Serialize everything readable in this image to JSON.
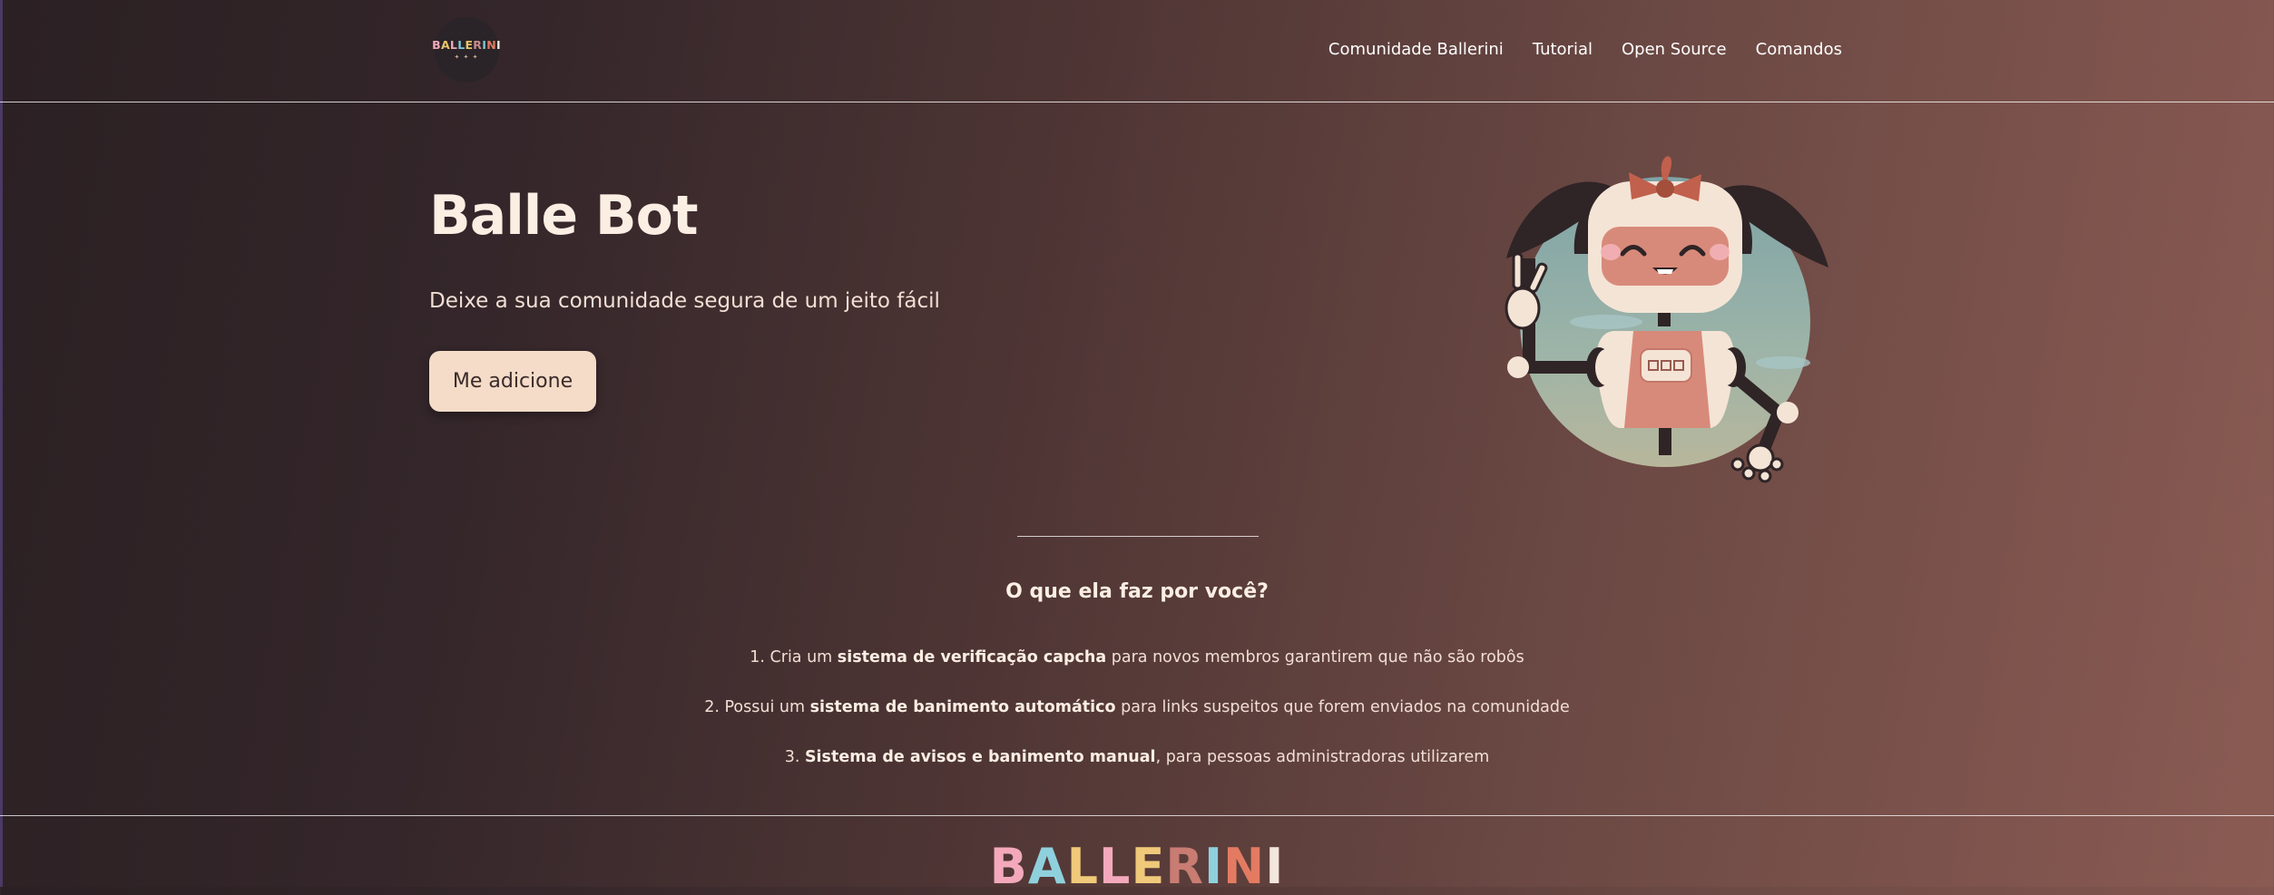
{
  "header": {
    "logo_text": "BALLERINI",
    "logo_sub": "✦ ✦ ✦",
    "nav": [
      "Comunidade Ballerini",
      "Tutorial",
      "Open Source",
      "Comandos"
    ]
  },
  "hero": {
    "title": "Balle Bot",
    "subtitle": "Deixe a sua comunidade segura de um jeito fácil",
    "cta_label": "Me adicione",
    "robot_icon": "robot-mascot-icon"
  },
  "features": {
    "title": "O que ela faz por você?",
    "items": [
      {
        "prefix": "1. Cria um ",
        "bold": "sistema de verificação capcha",
        "suffix": " para novos membros garantirem que não são robôs"
      },
      {
        "prefix": "2. Possui um ",
        "bold": "sistema de banimento automático",
        "suffix": " para links suspeitos que forem enviados na comunidade"
      },
      {
        "prefix": "3. ",
        "bold": "Sistema de avisos e banimento manual",
        "suffix": ", para pessoas administradoras utilizarem"
      }
    ]
  },
  "footer": {
    "logo_text": "BALLERINI"
  },
  "colors": {
    "accent_button": "#f4dcc8",
    "text_light": "#fbeee3",
    "bg_dark": "#2b2023",
    "bg_warm": "#8a5b53"
  }
}
